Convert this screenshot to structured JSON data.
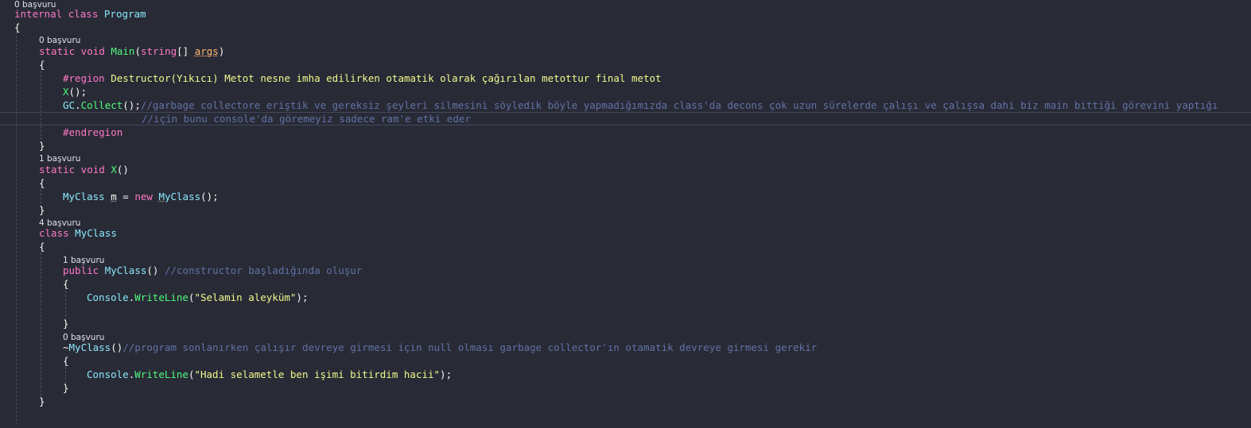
{
  "codelens": {
    "program": "0 başvuru",
    "main": "0 başvuru",
    "x": "1 başvuru",
    "myclass": "4 başvuru",
    "ctor": "1 başvuru",
    "dtor": "0 başvuru"
  },
  "code": {
    "l1": {
      "kw": "internal class",
      "name": "Program"
    },
    "brace_open": "{",
    "brace_close": "}",
    "main_sig": {
      "kw": "static void",
      "name": "Main",
      "open": "(",
      "type": "string",
      "arr": "[]",
      "param": "args",
      "close": ")"
    },
    "region": {
      "directive": "#region",
      "text": "Destructor(Yıkıcı) Metot nesne imha edilirken otamatik olarak çağırılan metottur final metot"
    },
    "call_x": {
      "name": "X",
      "rest": "();"
    },
    "gc": {
      "type": "GC",
      "dot": ".",
      "method": "Collect",
      "rest": "();",
      "comment": "//garbage collectore eriştik ve gereksiz şeyleri silmesini söyledik böyle yapmadığımızda class'da decons çok uzun sürelerde çalışı ve çalışsa dahi biz main bittiği görevini yaptığı"
    },
    "gc_comment2": "//için bunu console'da göremeyiz sadece ram'e etki eder",
    "endregion": "#endregion",
    "x_sig": {
      "kw": "static void",
      "name": "X",
      "rest": "()"
    },
    "x_body": {
      "type": "MyClass",
      "var": "m",
      "eq": " = ",
      "kw": "new",
      "ctor_first": "M",
      "ctor_rest": "yClass",
      "rest": "();"
    },
    "class_decl": {
      "kw": "class",
      "name": "MyClass"
    },
    "ctor_sig": {
      "kw": "public",
      "name": "MyClass",
      "rest": "()",
      "comment": "//constructor başladığında oluşur"
    },
    "ctor_body": {
      "type": "Console",
      "dot": ".",
      "method": "WriteLine",
      "open": "(",
      "str": "\"Selamin aleyküm\"",
      "close": ");"
    },
    "dtor_sig": {
      "tilde": "~",
      "name": "MyClass",
      "rest": "()",
      "comment": "//program sonlanırken çalışır devreye girmesi için null olması garbage collector'ın otamatik devreye girmesi gerekir"
    },
    "dtor_body": {
      "type": "Console",
      "dot": ".",
      "method": "WriteLine",
      "open": "(",
      "str": "\"Hadi selametle ben işimi bitirdim hacii\"",
      "close": ");"
    }
  },
  "colors": {
    "background": "#282a36",
    "keyword": "#ff79c6",
    "type": "#8be9fd",
    "method": "#50fa7b",
    "parameter": "#ffb86c",
    "string": "#f1fa8c",
    "comment": "#6272a4"
  }
}
